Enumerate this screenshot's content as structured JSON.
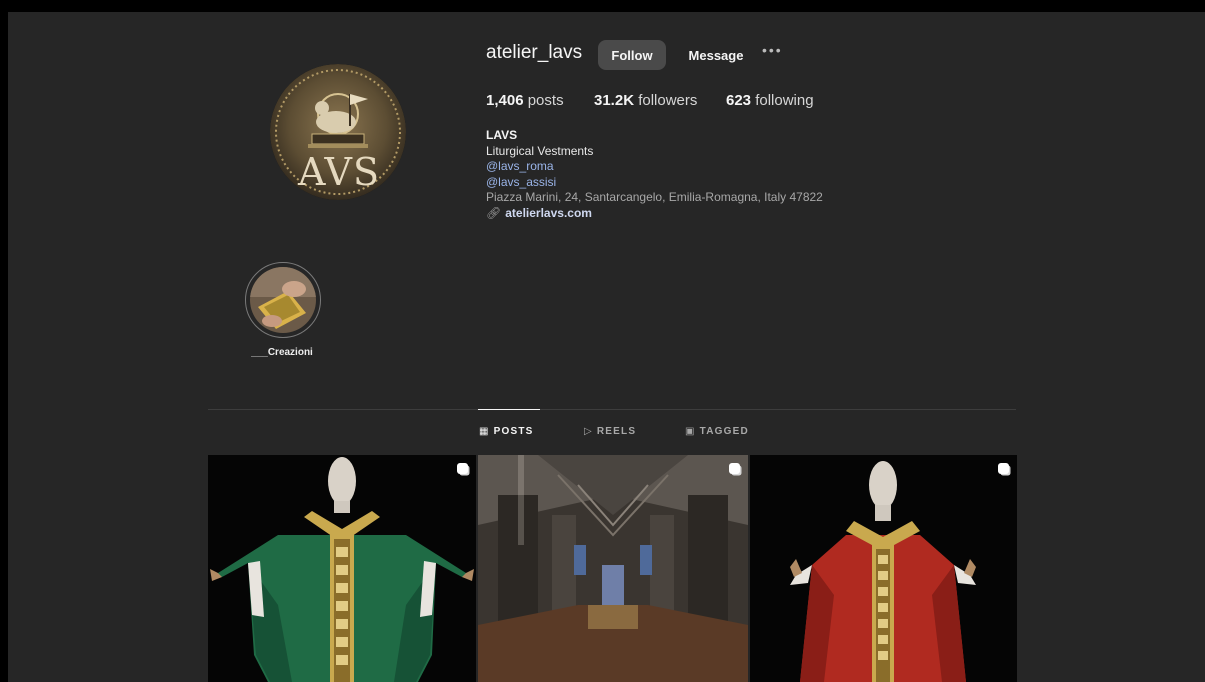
{
  "profile": {
    "username": "atelier_lavs",
    "avatar_text": "AVS",
    "follow_label": "Follow",
    "message_label": "Message",
    "more_label": "•••"
  },
  "stats": {
    "posts_count": "1,406",
    "posts_label": "posts",
    "followers_count": "31.2K",
    "followers_label": "followers",
    "following_count": "623",
    "following_label": "following"
  },
  "bio": {
    "name": "LAVS",
    "category": "Liturgical Vestments",
    "link1": "@lavs_roma",
    "link2": "@lavs_assisi",
    "address": "Piazza Marini, 24, Santarcangelo, Emilia-Romagna, Italy 47822",
    "website": "atelierlavs.com"
  },
  "highlights": [
    {
      "label": "___Creazioni"
    }
  ],
  "tabs": [
    {
      "label": "POSTS",
      "icon": "grid-icon",
      "active": true
    },
    {
      "label": "REELS",
      "icon": "reels-icon",
      "active": false
    },
    {
      "label": "TAGGED",
      "icon": "tagged-icon",
      "active": false
    }
  ],
  "posts": [
    {
      "subject": "green chasuble on mannequin",
      "multi": true
    },
    {
      "subject": "cathedral interior",
      "multi": true
    },
    {
      "subject": "red chasuble on mannequin",
      "multi": true
    }
  ],
  "colors": {
    "background": "#262626",
    "link": "#9ab4e8",
    "follow_button": "#4a4a4a",
    "green_vestment": "#1f6b45",
    "red_vestment": "#b02a20",
    "gold_trim": "#c9a94e"
  }
}
